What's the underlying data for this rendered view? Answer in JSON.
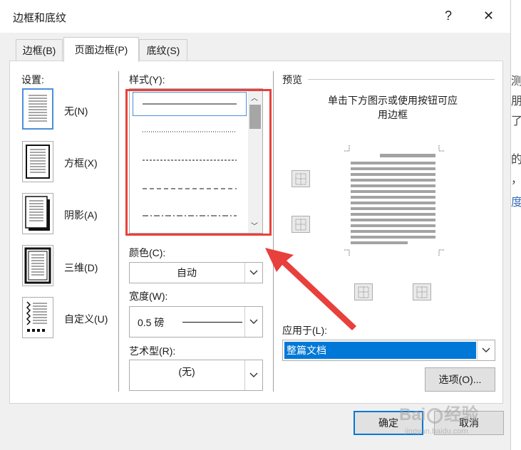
{
  "window": {
    "title": "边框和底纹",
    "help_glyph": "?",
    "close_glyph": "✕"
  },
  "tabs": [
    {
      "label": "边框(B)",
      "active": false
    },
    {
      "label": "页面边框(P)",
      "active": true
    },
    {
      "label": "底纹(S)",
      "active": false
    }
  ],
  "settings": {
    "heading": "设置:",
    "items": [
      {
        "label": "无(N)",
        "icon": "none-setting-icon"
      },
      {
        "label": "方框(X)",
        "icon": "box-setting-icon"
      },
      {
        "label": "阴影(A)",
        "icon": "shadow-setting-icon"
      },
      {
        "label": "三维(D)",
        "icon": "3d-setting-icon"
      },
      {
        "label": "自定义(U)",
        "icon": "custom-setting-icon"
      }
    ]
  },
  "style": {
    "label": "样式(Y):"
  },
  "color": {
    "label": "颜色(C):",
    "value": "自动"
  },
  "width": {
    "label": "宽度(W):",
    "value": "0.5 磅"
  },
  "art": {
    "label": "艺术型(R):",
    "value": "(无)"
  },
  "preview": {
    "heading": "预览",
    "hint_line1": "单击下方图示或使用按钮可应",
    "hint_line2": "用边框"
  },
  "apply_to": {
    "label": "应用于(L):",
    "value": "整篇文档"
  },
  "buttons": {
    "options": "选项(O)...",
    "ok": "确定",
    "cancel": "取消"
  },
  "watermark": {
    "text1": "Bai",
    "text2": "经验",
    "text3": "jingyan.baidu.com"
  },
  "background_text": [
    "测",
    "朋，",
    "了",
    "的",
    "，",
    "度"
  ],
  "colors": {
    "highlight_box": "#e8403c",
    "arrow": "#e8403c",
    "selection": "#0078d7",
    "accent": "#4a90d9"
  }
}
